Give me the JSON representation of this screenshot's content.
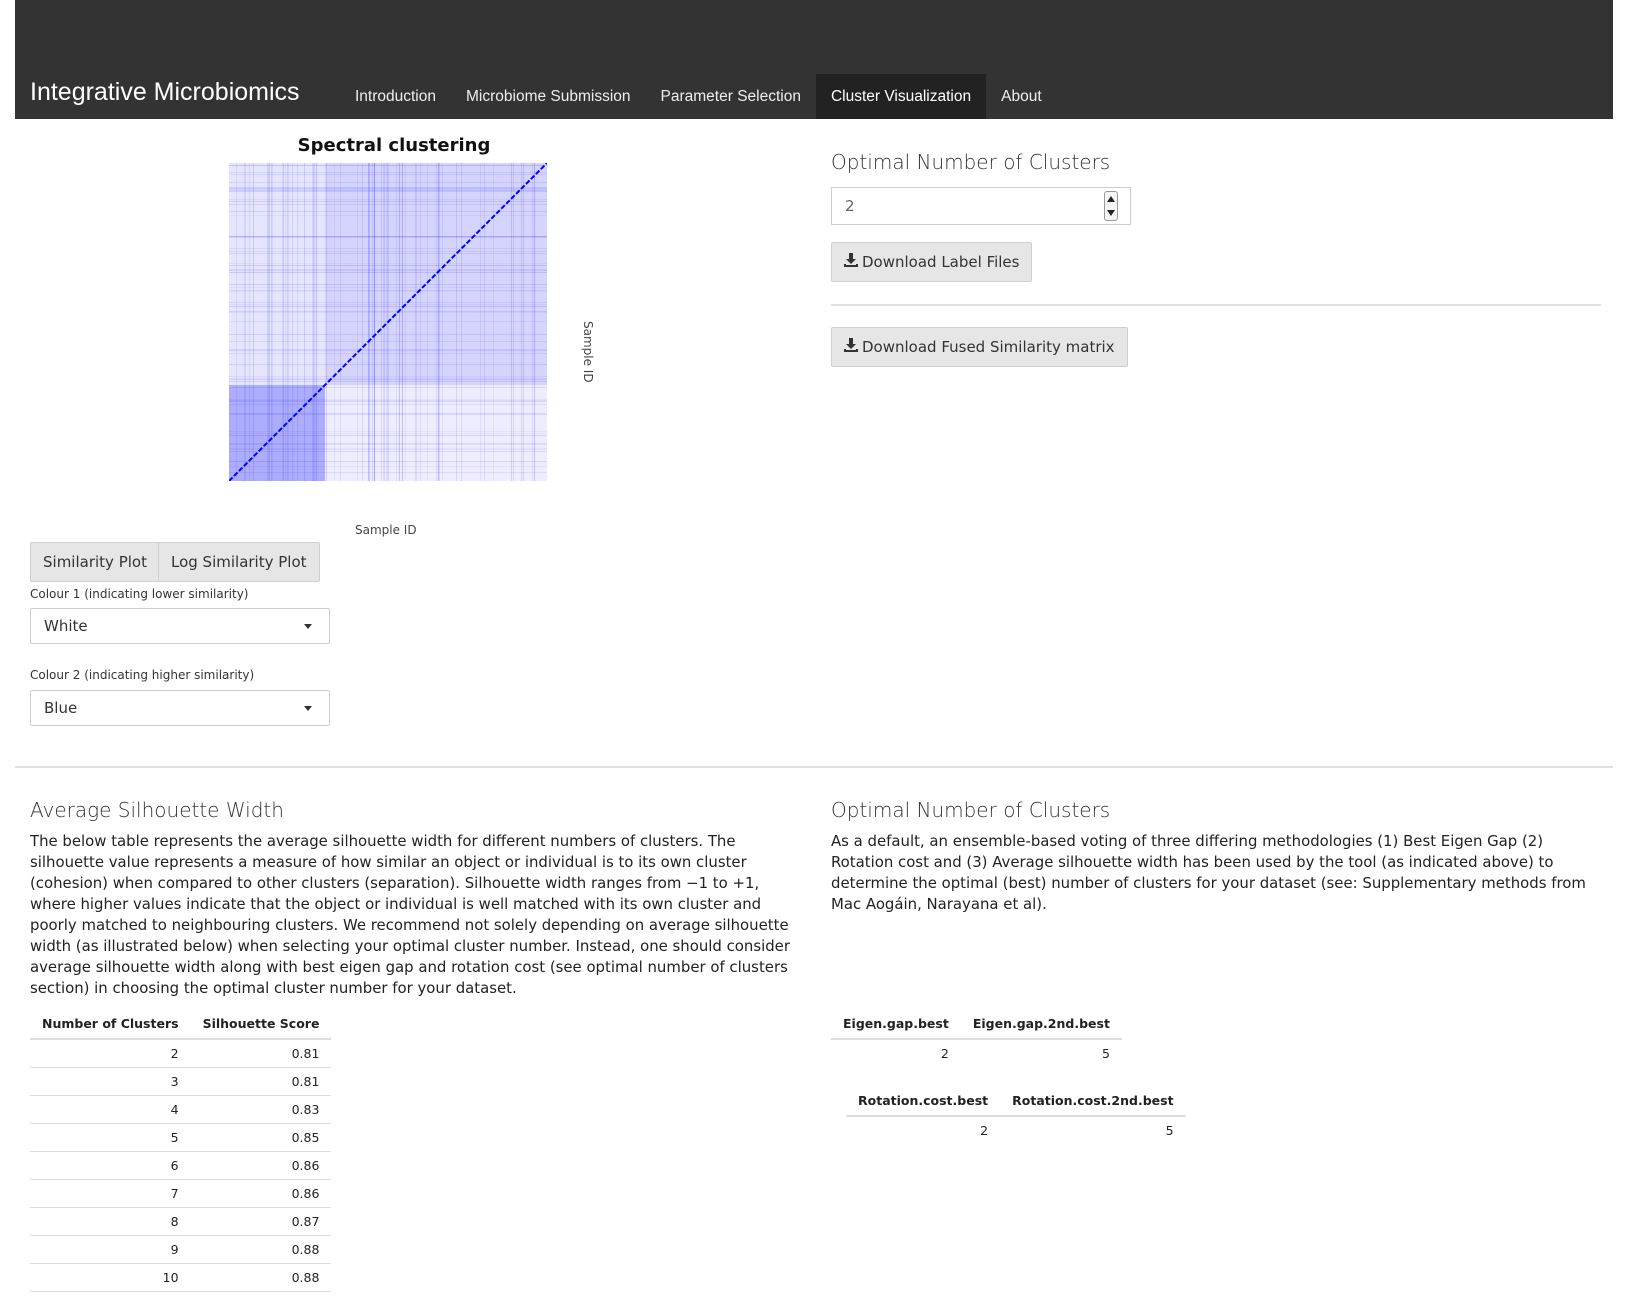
{
  "navbar": {
    "brand": "Integrative Microbiomics",
    "items": [
      {
        "label": "Introduction"
      },
      {
        "label": "Microbiome Submission"
      },
      {
        "label": "Parameter Selection"
      },
      {
        "label": "Cluster Visualization"
      },
      {
        "label": "About"
      }
    ],
    "active_index": 3
  },
  "plot": {
    "title": "Spectral clustering",
    "xlabel": "Sample ID",
    "ylabel": "Sample ID",
    "colors": {
      "low": "#ffffff",
      "high": "#0000ff"
    }
  },
  "plot_buttons": {
    "similarity": "Similarity Plot",
    "log_similarity": "Log Similarity Plot"
  },
  "colour1": {
    "label": "Colour 1 (indicating lower similarity)",
    "value": "White"
  },
  "colour2": {
    "label": "Colour 2 (indicating higher similarity)",
    "value": "Blue"
  },
  "optimal_panel": {
    "title": "Optimal Number of Clusters",
    "value": "2",
    "download_labels": "Download Label Files",
    "download_matrix": "Download Fused Similarity matrix"
  },
  "silhouette": {
    "title": "Average Silhouette Width",
    "description": "The below table represents the average silhouette width for different numbers of clusters. The silhouette value represents a measure of how similar an object or individual is to its own cluster (cohesion) when compared to other clusters (separation). Silhouette width ranges from −1 to +1, where higher values indicate that the object or individual is well matched with its own cluster and poorly matched to neighbouring clusters. We recommend not solely depending on average silhouette width (as illustrated below) when selecting your optimal cluster number. Instead, one should consider average silhouette width along with best eigen gap and rotation cost (see optimal number of clusters section) in choosing the optimal cluster number for your dataset.",
    "headers": [
      "Number of Clusters",
      "Silhouette Score"
    ],
    "rows": [
      [
        "2",
        "0.81"
      ],
      [
        "3",
        "0.81"
      ],
      [
        "4",
        "0.83"
      ],
      [
        "5",
        "0.85"
      ],
      [
        "6",
        "0.86"
      ],
      [
        "7",
        "0.86"
      ],
      [
        "8",
        "0.87"
      ],
      [
        "9",
        "0.88"
      ],
      [
        "10",
        "0.88"
      ]
    ]
  },
  "optimal_info": {
    "title": "Optimal Number of Clusters",
    "description": "As a default, an ensemble-based voting of three differing methodologies (1) Best Eigen Gap (2) Rotation cost and (3) Average silhouette width has been used by the tool (as indicated above) to determine the optimal (best) number of clusters for your dataset (see: Supplementary methods from Mac Aogáin, Narayana et al).",
    "eigen_headers": [
      "Eigen.gap.best",
      "Eigen.gap.2nd.best"
    ],
    "eigen_values": [
      "2",
      "5"
    ],
    "rotation_headers": [
      "Rotation.cost.best",
      "Rotation.cost.2nd.best"
    ],
    "rotation_values": [
      "2",
      "5"
    ]
  }
}
